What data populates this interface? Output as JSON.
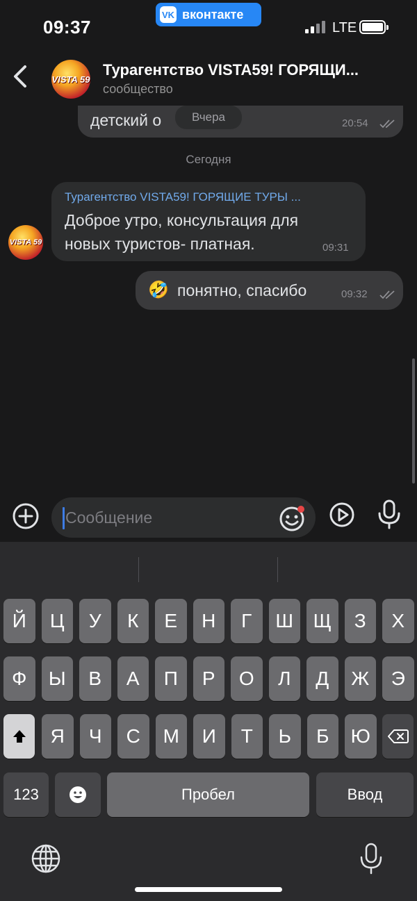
{
  "status_bar": {
    "time": "09:37",
    "app_badge": "вконтакте",
    "app_badge_logo": "VK",
    "network": "LTE"
  },
  "header": {
    "title": "Турагентство VISTA59! ГОРЯЩИ...",
    "subtitle": "сообщество",
    "avatar_text": "VISTA 59"
  },
  "messages": {
    "earlier_out": {
      "text": "детский о",
      "time": "20:54"
    },
    "sticky_date": "Вчера",
    "today_label": "Сегодня",
    "incoming": {
      "sender": "Турагентство VISTA59! ГОРЯЩИЕ ТУРЫ ...",
      "line1": "Доброе утро, консультация для",
      "line2": "новых туристов- платная.",
      "time": "09:31"
    },
    "outgoing": {
      "emoji": "🤣",
      "text": "понятно, спасибо",
      "time": "09:32"
    }
  },
  "input": {
    "placeholder": "Сообщение"
  },
  "keyboard": {
    "row1": [
      "Й",
      "Ц",
      "У",
      "К",
      "Е",
      "Н",
      "Г",
      "Ш",
      "Щ",
      "З",
      "Х"
    ],
    "row2": [
      "Ф",
      "Ы",
      "В",
      "А",
      "П",
      "Р",
      "О",
      "Л",
      "Д",
      "Ж",
      "Э"
    ],
    "row3": [
      "Я",
      "Ч",
      "С",
      "М",
      "И",
      "Т",
      "Ь",
      "Б",
      "Ю"
    ],
    "numbers_key": "123",
    "space_key": "Пробел",
    "return_key": "Ввод"
  },
  "colors": {
    "background": "#19191a",
    "accent_blue": "#2787f5",
    "link_blue": "#71aaeb"
  }
}
